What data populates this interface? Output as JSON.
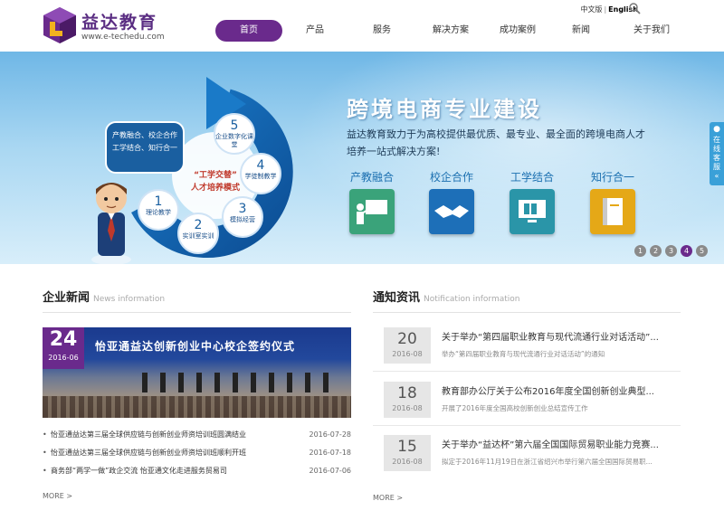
{
  "header": {
    "logo_title": "益达教育",
    "logo_url": "www.e-techedu.com",
    "lang_cn": "中文版",
    "lang_sep": "|",
    "lang_en": "English",
    "nav": [
      {
        "label": "首页",
        "active": true
      },
      {
        "label": "产品",
        "active": false
      },
      {
        "label": "服务",
        "active": false
      },
      {
        "label": "解决方案",
        "active": false
      },
      {
        "label": "成功案例",
        "active": false
      },
      {
        "label": "新闻",
        "active": false
      },
      {
        "label": "关于我们",
        "active": false
      }
    ]
  },
  "banner": {
    "title": "跨境电商专业建设",
    "description": "益达教育致力于为高校提供最优质、最专业、最全面的跨境电商人才培养一站式解决方案!",
    "features": [
      {
        "label": "产教融合",
        "color": "#3aa37a"
      },
      {
        "label": "校企合作",
        "color": "#1d6fb8"
      },
      {
        "label": "工学结合",
        "color": "#2a95a8"
      },
      {
        "label": "知行合一",
        "color": "#e5a817"
      }
    ],
    "cycle": {
      "pill_lines": [
        "产教融合、校企合作",
        "工学结合、知行合一"
      ],
      "center_lines": [
        "“工学交替”",
        "人才培养模式"
      ],
      "nodes": [
        {
          "num": "1",
          "label": "理论教学"
        },
        {
          "num": "2",
          "label": "实训室实训"
        },
        {
          "num": "3",
          "label": "模拟经营"
        },
        {
          "num": "4",
          "label": "学徒制教学"
        },
        {
          "num": "5",
          "label": "企业数字化课堂"
        }
      ]
    },
    "pager": [
      "1",
      "2",
      "3",
      "4",
      "5"
    ],
    "pager_active": 4
  },
  "side_service": {
    "label": "在线客服",
    "arrow": "«"
  },
  "news": {
    "title": "企业新闻",
    "subtitle": "News information",
    "featured": {
      "day": "24",
      "year_month": "2016-06",
      "image_title": "怡亚通益达创新创业中心校企签约仪式"
    },
    "items": [
      {
        "title": "怡亚通益达第三届全球供应链与创新创业师资培训班圆满结业",
        "date": "2016-07-28"
      },
      {
        "title": "怡亚通益达第三届全球供应链与创新创业师资培训班顺利开班",
        "date": "2016-07-18"
      },
      {
        "title": "商务部“两学一做”政企交流 怡亚通文化走进服务贸易司",
        "date": "2016-07-06"
      }
    ],
    "more": "MORE >"
  },
  "notices": {
    "title": "通知资讯",
    "subtitle": "Notification information",
    "items": [
      {
        "day": "20",
        "year_month": "2016-08",
        "title": "关于举办“第四届职业教育与现代流通行业对话活动”...",
        "summary": "举办“第四届职业教育与现代流通行业对话活动”的通知"
      },
      {
        "day": "18",
        "year_month": "2016-08",
        "title": "教育部办公厅关于公布2016年度全国创新创业典型...",
        "summary": "开展了2016年度全国高校创新创业总结宣传工作"
      },
      {
        "day": "15",
        "year_month": "2016-08",
        "title": "关于举办“益达杯”第六届全国国际贸易职业能力竞赛...",
        "summary": "拟定于2016年11月19日在浙江省绍兴市举行第六届全国国际贸易职..."
      }
    ],
    "more": "MORE >"
  }
}
